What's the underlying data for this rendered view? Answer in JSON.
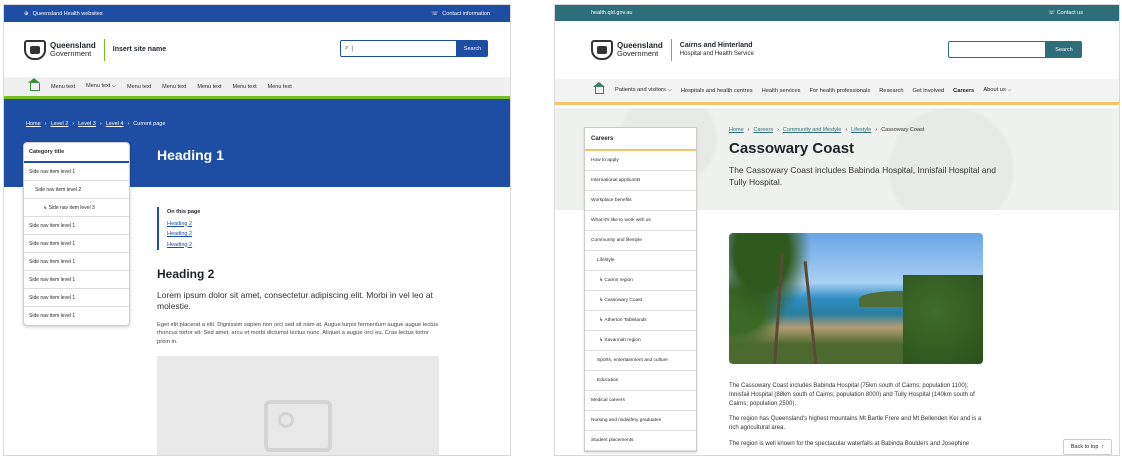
{
  "left": {
    "topbar": {
      "site_link": "Queensland Health websites",
      "contact": "Contact information"
    },
    "brand": {
      "line1": "Queensland",
      "line2": "Government"
    },
    "site_name": "Insert site name",
    "search": {
      "value": "|",
      "button": "Search"
    },
    "nav": [
      "Menu text",
      "Menu text",
      "Menu text",
      "Menu text",
      "Menu text",
      "Menu text",
      "Menu text"
    ],
    "breadcrumb": [
      "Home",
      "Level 2",
      "Level 3",
      "Level 4",
      "Current page"
    ],
    "heading1": "Heading 1",
    "sidenav": {
      "title": "Category title",
      "items": [
        "Side nav item level 1",
        "Side nav item level 2",
        "Side nav item level 3",
        "Side nav item level 1",
        "Side nav item level 1",
        "Side nav item level 1",
        "Side nav item level 1",
        "Side nav item level 1",
        "Side nav item level 1"
      ]
    },
    "on_this_page": {
      "title": "On this page",
      "links": [
        "Heading 2",
        "Heading 2",
        "Heading 2"
      ]
    },
    "heading2": "Heading 2",
    "lead": "Lorem ipsum dolor sit amet, consectetur adipiscing elit. Morbi in vel leo at molestie.",
    "body": "Eget elit placerat a elit. Dignissim sapien non orci sed sit nam at. Augue turpis fermentum augue augue lectus rhoncus tortor sit. Sed amet, arcu et morbi dictumst lectus nunc. Aliquet a augue orci eu. Cras lectus tortor proin in."
  },
  "right": {
    "topbar": {
      "url": "health.qld.gov.au",
      "contact": "Contact us"
    },
    "brand": {
      "line1": "Queensland",
      "line2": "Government"
    },
    "site_name": "Cairns and Hinterland",
    "site_sub": "Hospital and Health Service",
    "search": {
      "button": "Search"
    },
    "nav": [
      "Patients and visitors",
      "Hospitals and health centres",
      "Health services",
      "For health professionals",
      "Research",
      "Get involved",
      "Careers",
      "About us"
    ],
    "sidenav": {
      "title": "Careers",
      "items": [
        "How to apply",
        "International applicants",
        "Workplace benefits",
        "What it's like to work with us",
        "Community and lifestyle",
        "Lifestyle",
        "Cairns region",
        "Cassowary Coast",
        "Atherton Tablelands",
        "Savannah region",
        "Sports, entertainment and culture",
        "Education",
        "Medical careers",
        "Nursing and midwifery graduates",
        "Student placements"
      ]
    },
    "breadcrumb": [
      "Home",
      "Careers",
      "Community and lifestyle",
      "Lifestyle",
      "Cassowary Coast"
    ],
    "heading1": "Cassowary Coast",
    "lead": "The Cassowary Coast includes Babinda Hospital, Innisfail Hospital and Tully Hospital.",
    "paragraphs": [
      "The Cassowary Coast includes Babinda Hospital (75km south of Cairns; population 1100); Innisfail Hospital (88km south of Cairns; population 8000) and Tully Hospital (140km south of Cairns; population 2500).",
      "The region has Queensland's highest mountains Mt Bartle Frere and Mt Bellenden Ker and is a rich agricultural area.",
      "The region is well known for the spectacular waterfalls at Babinda Boulders and Josephine"
    ],
    "back_to_top": "Back to top"
  }
}
